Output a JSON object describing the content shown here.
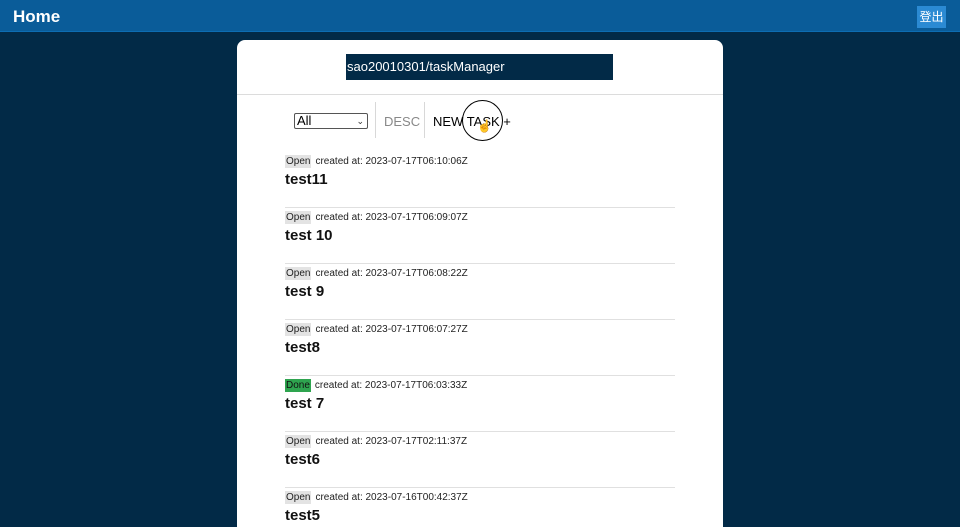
{
  "header": {
    "home_label": "Home",
    "logout_label": "登出"
  },
  "repo": {
    "name": "sao20010301/taskManager"
  },
  "toolbar": {
    "filter_value": "All",
    "sort_label": "DESC",
    "new_task_label": "NEW TASK +"
  },
  "tasks": [
    {
      "status": "Open",
      "created": "created at: 2023-07-17T06:10:06Z",
      "title": "test11"
    },
    {
      "status": "Open",
      "created": "created at: 2023-07-17T06:09:07Z",
      "title": "test 10"
    },
    {
      "status": "Open",
      "created": "created at: 2023-07-17T06:08:22Z",
      "title": "test 9"
    },
    {
      "status": "Open",
      "created": "created at: 2023-07-17T06:07:27Z",
      "title": "test8"
    },
    {
      "status": "Done",
      "created": "created at: 2023-07-17T06:03:33Z",
      "title": "test 7"
    },
    {
      "status": "Open",
      "created": "created at: 2023-07-17T02:11:37Z",
      "title": "test6"
    },
    {
      "status": "Open",
      "created": "created at: 2023-07-16T00:42:37Z",
      "title": "test5"
    }
  ],
  "colors": {
    "topbar": "#0a5c99",
    "background": "#022a47",
    "done_badge": "#2ea44f",
    "open_badge": "#e3e3e3"
  }
}
